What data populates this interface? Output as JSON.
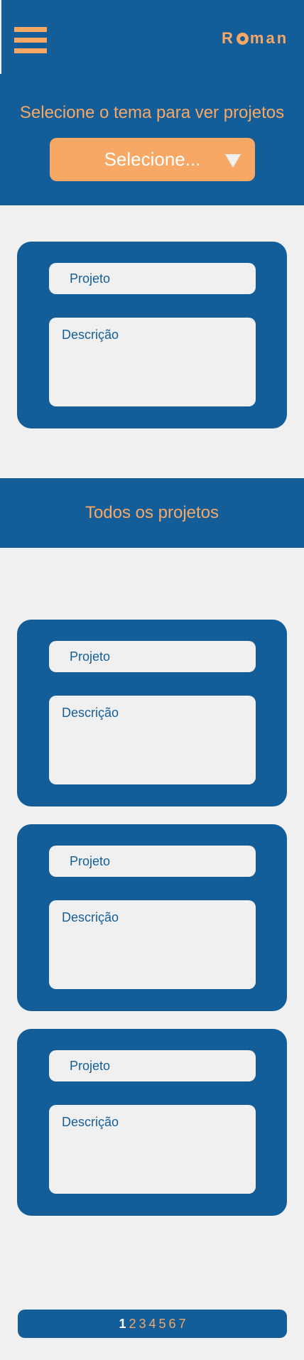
{
  "header": {
    "logo": "Roman",
    "select_title": "Selecione o tema para ver projetos",
    "select_value": "Selecione..."
  },
  "colors": {
    "primary": "#135e99",
    "accent": "#f7a865",
    "background": "#f0f0f0"
  },
  "form_card": {
    "project_placeholder": "Projeto",
    "description_placeholder": "Descrição"
  },
  "all_projects": {
    "title": "Todos os projetos",
    "cards": [
      {
        "project_placeholder": "Projeto",
        "description_placeholder": "Descrição"
      },
      {
        "project_placeholder": "Projeto",
        "description_placeholder": "Descrição"
      },
      {
        "project_placeholder": "Projeto",
        "description_placeholder": "Descrição"
      }
    ]
  },
  "pagination": {
    "pages": [
      "1",
      "2",
      "3",
      "4",
      "5",
      "6",
      "7"
    ],
    "active": "1"
  }
}
